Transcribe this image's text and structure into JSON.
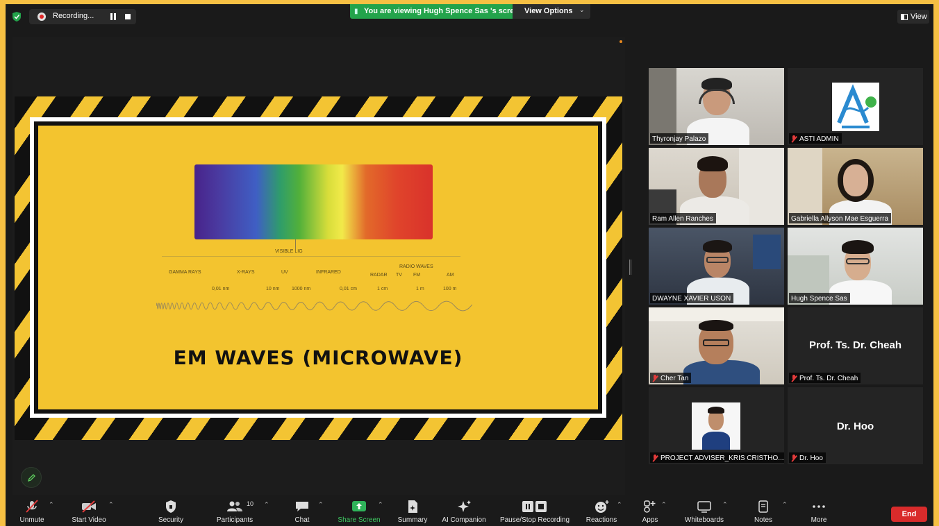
{
  "topbar": {
    "recording_label": "Recording...",
    "viewing_banner": "You are viewing Hugh Spence Sas 's screen",
    "view_options_label": "View Options",
    "view_label": "View"
  },
  "slide": {
    "visible_light_label": "VISIBLE LIG",
    "band_labels": [
      "GAMMA RAYS",
      "X-RAYS",
      "UV",
      "INFRARED",
      "RADIO WAVES",
      "RADAR",
      "TV",
      "FM",
      "AM"
    ],
    "wavelengths": [
      "0,01 nm",
      "10 nm",
      "1000 nm",
      "0,01 cm",
      "1 cm",
      "1 m",
      "100 m"
    ],
    "title": "EM WAVES (MICROWAVE)"
  },
  "participants": [
    {
      "name": "Thyronjay Palazo",
      "muted": false
    },
    {
      "name": "ASTI ADMIN",
      "muted": true
    },
    {
      "name": "Ram Allen Ranches",
      "muted": false
    },
    {
      "name": "Gabriella Allyson Mae Esguerra",
      "muted": false
    },
    {
      "name": "DWAYNE XAVIER USON",
      "muted": false
    },
    {
      "name": "Hugh Spence Sas",
      "muted": false,
      "active_speaker": true
    },
    {
      "name": "Cher Tan",
      "muted": true
    },
    {
      "name": "Prof. Ts. Dr. Cheah",
      "muted": true,
      "display_name": "Prof. Ts. Dr. Cheah"
    },
    {
      "name": "PROJECT ADVISER_KRIS CRISTHO...",
      "muted": true
    },
    {
      "name": "Dr. Hoo",
      "muted": true,
      "display_name": "Dr. Hoo"
    }
  ],
  "toolbar": {
    "unmute": "Unmute",
    "start_video": "Start Video",
    "security": "Security",
    "participants": "Participants",
    "participants_count": "10",
    "chat": "Chat",
    "share_screen": "Share Screen",
    "summary": "Summary",
    "ai_companion": "AI Companion",
    "pause_stop_recording": "Pause/Stop Recording",
    "reactions": "Reactions",
    "apps": "Apps",
    "whiteboards": "Whiteboards",
    "notes": "Notes",
    "more": "More",
    "end": "End"
  },
  "colors": {
    "background": "#f6c043",
    "app_bg": "#1a1a1a",
    "banner_green": "#23a34b",
    "end_red": "#d92b2b",
    "active_speaker_border": "#c9e98a",
    "share_green": "#3fca62"
  }
}
